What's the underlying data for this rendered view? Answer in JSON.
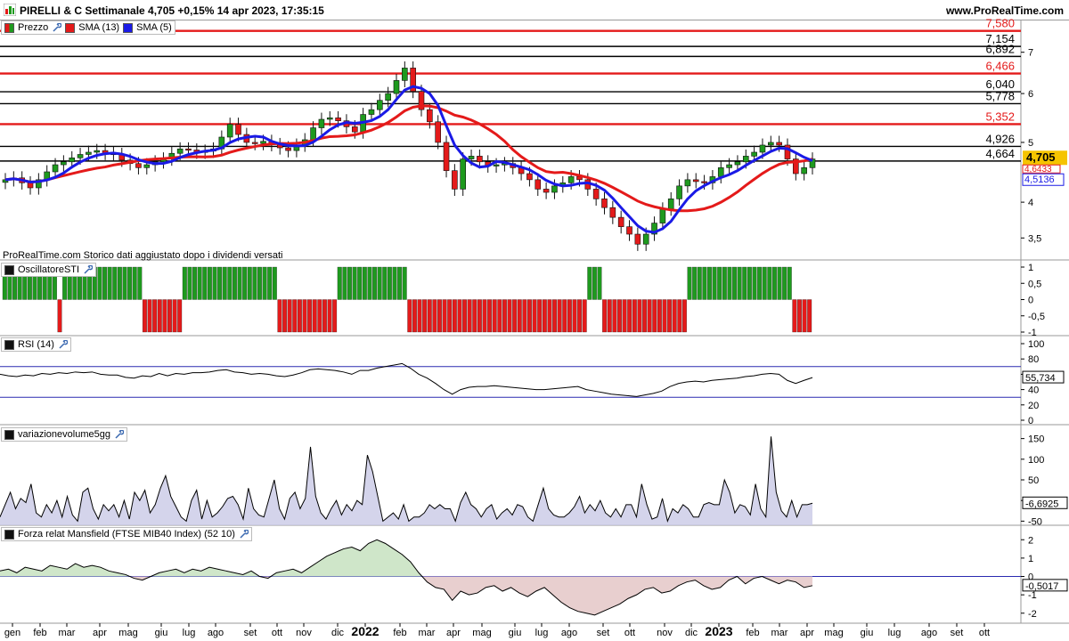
{
  "header": {
    "title": "PIRELLI & C Settimanale 4,705 +0,15% 14 apr 2023, 17:35:15",
    "site": "www.ProRealTime.com"
  },
  "colors": {
    "red": "#e41a1a",
    "blue": "#1a1ae6",
    "green": "#1e9a1e",
    "accent_price_bg": "#f5c400"
  },
  "icons": [
    "prorealtime-logo-icon",
    "wrench-icon"
  ],
  "main_legend": {
    "price": "Prezzo",
    "sma13": "SMA (13)",
    "sma5": "SMA (5)"
  },
  "note": "ProRealTime.com  Storico dati aggiustato dopo i dividendi versati",
  "levels": [
    {
      "value": 7.58,
      "label": "7,580",
      "color": "red"
    },
    {
      "value": 7.154,
      "label": "7,154",
      "color": "black"
    },
    {
      "value": 6.892,
      "label": "6,892",
      "color": "black"
    },
    {
      "value": 6.466,
      "label": "6,466",
      "color": "red"
    },
    {
      "value": 6.04,
      "label": "6,040",
      "color": "black"
    },
    {
      "value": 5.778,
      "label": "5,778",
      "color": "black"
    },
    {
      "value": 5.352,
      "label": "5,352",
      "color": "red"
    },
    {
      "value": 4.926,
      "label": "4,926",
      "color": "black"
    },
    {
      "value": 4.664,
      "label": "4,664",
      "color": "black"
    }
  ],
  "price_badges": {
    "last": "4,705",
    "sma13": "4,6433",
    "sma5": "4,5136"
  },
  "x_axis": {
    "labels": [
      {
        "t": "gen",
        "x": 14
      },
      {
        "t": "feb",
        "x": 45
      },
      {
        "t": "mar",
        "x": 75
      },
      {
        "t": "apr",
        "x": 112
      },
      {
        "t": "mag",
        "x": 144
      },
      {
        "t": "giu",
        "x": 181
      },
      {
        "t": "lug",
        "x": 212
      },
      {
        "t": "ago",
        "x": 242
      },
      {
        "t": "set",
        "x": 281
      },
      {
        "t": "ott",
        "x": 311
      },
      {
        "t": "nov",
        "x": 341
      },
      {
        "t": "dic",
        "x": 379
      },
      {
        "t": "2022",
        "x": 410,
        "bold": true
      },
      {
        "t": "feb",
        "x": 449
      },
      {
        "t": "mar",
        "x": 479
      },
      {
        "t": "apr",
        "x": 509
      },
      {
        "t": "mag",
        "x": 541
      },
      {
        "t": "giu",
        "x": 578
      },
      {
        "t": "lug",
        "x": 608
      },
      {
        "t": "ago",
        "x": 639
      },
      {
        "t": "set",
        "x": 677
      },
      {
        "t": "ott",
        "x": 707
      },
      {
        "t": "nov",
        "x": 746
      },
      {
        "t": "dic",
        "x": 776
      },
      {
        "t": "2023",
        "x": 807,
        "bold": true
      },
      {
        "t": "feb",
        "x": 845
      },
      {
        "t": "mar",
        "x": 875
      },
      {
        "t": "apr",
        "x": 906
      },
      {
        "t": "mag",
        "x": 936
      },
      {
        "t": "giu",
        "x": 973
      },
      {
        "t": "lug",
        "x": 1004
      },
      {
        "t": "ago",
        "x": 1043
      },
      {
        "t": "set",
        "x": 1074
      },
      {
        "t": "ott",
        "x": 1105
      }
    ]
  },
  "panels": {
    "sti": {
      "name": "OscillatoreSTI",
      "ticks": [
        "1",
        "0,5",
        "0",
        "-0,5",
        "-1"
      ]
    },
    "rsi": {
      "name": "RSI (14)",
      "ticks": [
        "100",
        "80",
        "60",
        "40",
        "20",
        "0"
      ],
      "last": "55,734"
    },
    "vol": {
      "name": "variazionevolume5gg",
      "ticks": [
        "150",
        "100",
        "50",
        "0",
        "-50"
      ],
      "last": "-6,6925"
    },
    "mansfield": {
      "name": "Forza relat Mansfield (FTSE MIB40 Index) (52 10)",
      "ticks": [
        "2",
        "1",
        "0",
        "-1",
        "-2"
      ],
      "last": "-0,5017"
    }
  },
  "price_axis_ticks": [
    "7",
    "6",
    "5",
    "4",
    "3,5"
  ],
  "chart_data": [
    {
      "type": "candlestick",
      "title": "PIRELLI & C Settimanale",
      "close_series": [
        4.35,
        4.38,
        4.3,
        4.22,
        4.35,
        4.48,
        4.6,
        4.65,
        4.72,
        4.78,
        4.82,
        4.85,
        4.8,
        4.78,
        4.68,
        4.62,
        4.55,
        4.6,
        4.65,
        4.7,
        4.8,
        4.88,
        4.86,
        4.82,
        4.84,
        4.88,
        5.1,
        5.35,
        5.15,
        5.0,
        4.98,
        5.02,
        4.96,
        4.9,
        4.85,
        4.95,
        5.05,
        5.28,
        5.45,
        5.48,
        5.42,
        5.3,
        5.2,
        5.55,
        5.65,
        5.85,
        6.0,
        6.3,
        6.6,
        6.05,
        5.65,
        5.4,
        5.0,
        4.5,
        4.2,
        4.7,
        4.75,
        4.65,
        4.58,
        4.6,
        4.62,
        4.55,
        4.45,
        4.35,
        4.2,
        4.15,
        4.25,
        4.3,
        4.4,
        4.35,
        4.2,
        4.05,
        3.92,
        3.78,
        3.65,
        3.55,
        3.42,
        3.55,
        3.7,
        3.9,
        4.05,
        4.25,
        4.35,
        4.32,
        4.3,
        4.4,
        4.55,
        4.6,
        4.65,
        4.75,
        4.82,
        4.95,
        5.0,
        4.95,
        4.7,
        4.45,
        4.55,
        4.7
      ],
      "sma13_last": 4.6433,
      "sma5_last": 4.5136,
      "ylim": [
        3.3,
        7.7
      ]
    },
    {
      "type": "bar",
      "title": "OscillatoreSTI",
      "values_sign": [
        1,
        1,
        1,
        1,
        1,
        1,
        1,
        1,
        1,
        1,
        1,
        -1,
        1,
        1,
        1,
        1,
        1,
        1,
        1,
        1,
        1,
        1,
        1,
        1,
        1,
        1,
        1,
        1,
        -1,
        -1,
        -1,
        -1,
        -1,
        -1,
        -1,
        -1,
        1,
        1,
        1,
        1,
        1,
        1,
        1,
        1,
        1,
        1,
        1,
        1,
        1,
        1,
        1,
        1,
        1,
        1,
        1,
        -1,
        -1,
        -1,
        -1,
        -1,
        -1,
        -1,
        -1,
        -1,
        -1,
        -1,
        -1,
        1,
        1,
        1,
        1,
        1,
        1,
        1,
        1,
        1,
        1,
        1,
        1,
        1,
        1,
        -1,
        -1,
        -1,
        -1,
        -1,
        -1,
        -1,
        -1,
        -1,
        -1,
        -1,
        -1,
        -1,
        -1,
        -1,
        -1,
        -1,
        -1,
        -1,
        -1,
        -1,
        -1,
        -1,
        -1,
        -1,
        -1,
        -1,
        -1,
        -1,
        -1,
        -1,
        -1,
        -1,
        -1,
        -1,
        -1,
        1,
        1,
        1,
        -1,
        -1,
        -1,
        -1,
        -1,
        -1,
        -1,
        -1,
        -1,
        -1,
        -1,
        -1,
        -1,
        -1,
        -1,
        -1,
        -1,
        1,
        1,
        1,
        1,
        1,
        1,
        1,
        1,
        1,
        1,
        1,
        1,
        1,
        1,
        1,
        1,
        1,
        1,
        1,
        1,
        1,
        -1,
        -1,
        -1,
        -1
      ],
      "ylim": [
        -1,
        1
      ]
    },
    {
      "type": "line",
      "title": "RSI (14)",
      "values": [
        60,
        58,
        57,
        59,
        58,
        61,
        60,
        62,
        61,
        63,
        62,
        63,
        60,
        59,
        59,
        56,
        55,
        58,
        57,
        61,
        58,
        61,
        60,
        62,
        62,
        63,
        65,
        66,
        63,
        62,
        60,
        61,
        60,
        58,
        57,
        59,
        62,
        66,
        67,
        66,
        65,
        63,
        60,
        65,
        65,
        68,
        70,
        72,
        74,
        68,
        60,
        55,
        48,
        40,
        34,
        40,
        43,
        44,
        44,
        45,
        44,
        43,
        42,
        41,
        40,
        40,
        41,
        42,
        43,
        44,
        40,
        38,
        36,
        34,
        33,
        32,
        31,
        33,
        35,
        38,
        44,
        48,
        50,
        51,
        50,
        52,
        53,
        54,
        55,
        57,
        58,
        60,
        61,
        60,
        52,
        48,
        52,
        55.7
      ],
      "ylim": [
        0,
        100
      ],
      "hlines": [
        70,
        30
      ],
      "last": 55.734
    },
    {
      "type": "area",
      "title": "variazionevolume5gg",
      "values": [
        -40,
        -10,
        20,
        -20,
        5,
        -5,
        40,
        -30,
        -40,
        -10,
        -30,
        0,
        -40,
        10,
        -35,
        -50,
        20,
        30,
        -20,
        -45,
        -10,
        -25,
        -10,
        -40,
        0,
        -45,
        20,
        0,
        25,
        -30,
        -10,
        30,
        60,
        10,
        -15,
        -40,
        -50,
        0,
        25,
        -45,
        0,
        -40,
        -30,
        -15,
        5,
        10,
        -10,
        -45,
        30,
        -20,
        -35,
        -40,
        5,
        50,
        -20,
        -45,
        5,
        20,
        -20,
        5,
        130,
        10,
        -30,
        -45,
        -20,
        0,
        -35,
        -10,
        -25,
        0,
        -10,
        110,
        70,
        10,
        -50,
        -40,
        -30,
        -45,
        -10,
        -50,
        -40,
        -40,
        -30,
        -10,
        -20,
        -10,
        -20,
        -20,
        -50,
        -5,
        20,
        -10,
        -20,
        -40,
        -20,
        -10,
        -45,
        -30,
        -20,
        -35,
        -10,
        -15,
        -40,
        -50,
        -10,
        30,
        -20,
        -35,
        -40,
        -40,
        -30,
        -15,
        10,
        -30,
        -10,
        -25,
        0,
        -30,
        -40,
        -20,
        -40,
        -10,
        -10,
        -40,
        40,
        -10,
        -45,
        -40,
        5,
        -50,
        -20,
        -30,
        -10,
        -20,
        -40,
        -40,
        -10,
        -5,
        -10,
        -10,
        50,
        20,
        -30,
        -10,
        -15,
        -35,
        40,
        -20,
        -40,
        155,
        20,
        -25,
        -40,
        0,
        -40,
        -10,
        -10,
        -6.69
      ],
      "ylim": [
        -60,
        160
      ],
      "last": -6.6925
    },
    {
      "type": "area",
      "title": "Forza relat Mansfield (FTSE MIB40 Index) (52 10)",
      "values": [
        0.3,
        0.4,
        0.2,
        0.5,
        0.4,
        0.3,
        0.6,
        0.5,
        0.4,
        0.7,
        0.5,
        0.6,
        0.5,
        0.3,
        0.2,
        0.1,
        -0.1,
        -0.2,
        0.0,
        0.2,
        0.3,
        0.4,
        0.2,
        0.4,
        0.3,
        0.5,
        0.4,
        0.3,
        0.2,
        0.1,
        0.3,
        0.0,
        -0.1,
        0.2,
        0.3,
        0.4,
        0.2,
        0.5,
        0.8,
        1.1,
        1.3,
        1.5,
        1.6,
        1.4,
        1.8,
        2.0,
        1.8,
        1.5,
        1.2,
        0.8,
        0.2,
        -0.3,
        -0.6,
        -0.7,
        -1.3,
        -0.8,
        -1.0,
        -0.9,
        -0.6,
        -0.5,
        -0.8,
        -0.6,
        -0.9,
        -1.1,
        -0.8,
        -0.6,
        -1.0,
        -1.4,
        -1.7,
        -1.9,
        -2.0,
        -2.1,
        -1.9,
        -1.7,
        -1.5,
        -1.2,
        -1.0,
        -0.7,
        -0.6,
        -0.9,
        -0.8,
        -0.5,
        -0.3,
        -0.2,
        -0.5,
        -0.7,
        -0.6,
        -0.2,
        0.0,
        -0.4,
        -0.1,
        0.0,
        -0.2,
        -0.4,
        -0.2,
        -0.3,
        -0.6,
        -0.5
      ],
      "ylim": [
        -2.4,
        2.4
      ],
      "last": -0.5017
    }
  ]
}
